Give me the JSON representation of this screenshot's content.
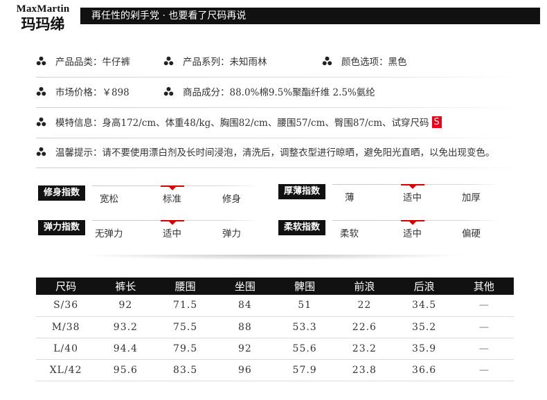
{
  "header": {
    "brand_en": "MaxMartin",
    "brand_cn": "玛玛绨",
    "slogan": "再任性的剁手党 · 也要看了尺码再说"
  },
  "info": {
    "row1": [
      {
        "label": "产品品类：牛仔裤"
      },
      {
        "label": "产品系列：未知雨林"
      },
      {
        "label": "颜色选项：黑色"
      }
    ],
    "row2": [
      {
        "label": "市场价格：￥898"
      },
      {
        "label": "商品成分：88.0%棉9.5%聚酯纤维 2.5%氨纶"
      }
    ],
    "model_info": "模特信息：身高172/cm、体重48/kg、胸围82/cm、腰围57/cm、臀围87/cm、试穿尺码",
    "model_size": "S",
    "care": "温馨提示：请不要使用漂白剂及长时间浸泡，清洗后，调整衣型进行晾晒，避免阳光直晒，以免出现变色。"
  },
  "indices": [
    {
      "label": "修身指数",
      "options": [
        "宽松",
        "标准",
        "修身"
      ],
      "selected_index": 1
    },
    {
      "label": "厚薄指数",
      "options": [
        "薄",
        "适中",
        "加厚"
      ],
      "selected_index": 1
    },
    {
      "label": "弹力指数",
      "options": [
        "无弹力",
        "适中",
        "弹力"
      ],
      "selected_index": 1
    },
    {
      "label": "柔软指数",
      "options": [
        "柔软",
        "适中",
        "偏硬"
      ],
      "selected_index": 1
    }
  ],
  "size_table": {
    "headers": [
      "尺码",
      "裤长",
      "腰围",
      "坐围",
      "髀围",
      "前浪",
      "后浪",
      "其他"
    ],
    "rows": [
      [
        "S/36",
        "92",
        "71.5",
        "84",
        "51",
        "22",
        "34.5",
        "—"
      ],
      [
        "M/38",
        "93.2",
        "75.5",
        "88",
        "53.3",
        "22.6",
        "35.2",
        "—"
      ],
      [
        "L/40",
        "94.4",
        "79.5",
        "92",
        "55.6",
        "23.2",
        "35.9",
        "—"
      ],
      [
        "XL/42",
        "95.6",
        "83.5",
        "96",
        "57.9",
        "23.8",
        "36.6",
        "—"
      ]
    ]
  },
  "colors": {
    "accent": "#e8001c",
    "dark": "#111111"
  }
}
